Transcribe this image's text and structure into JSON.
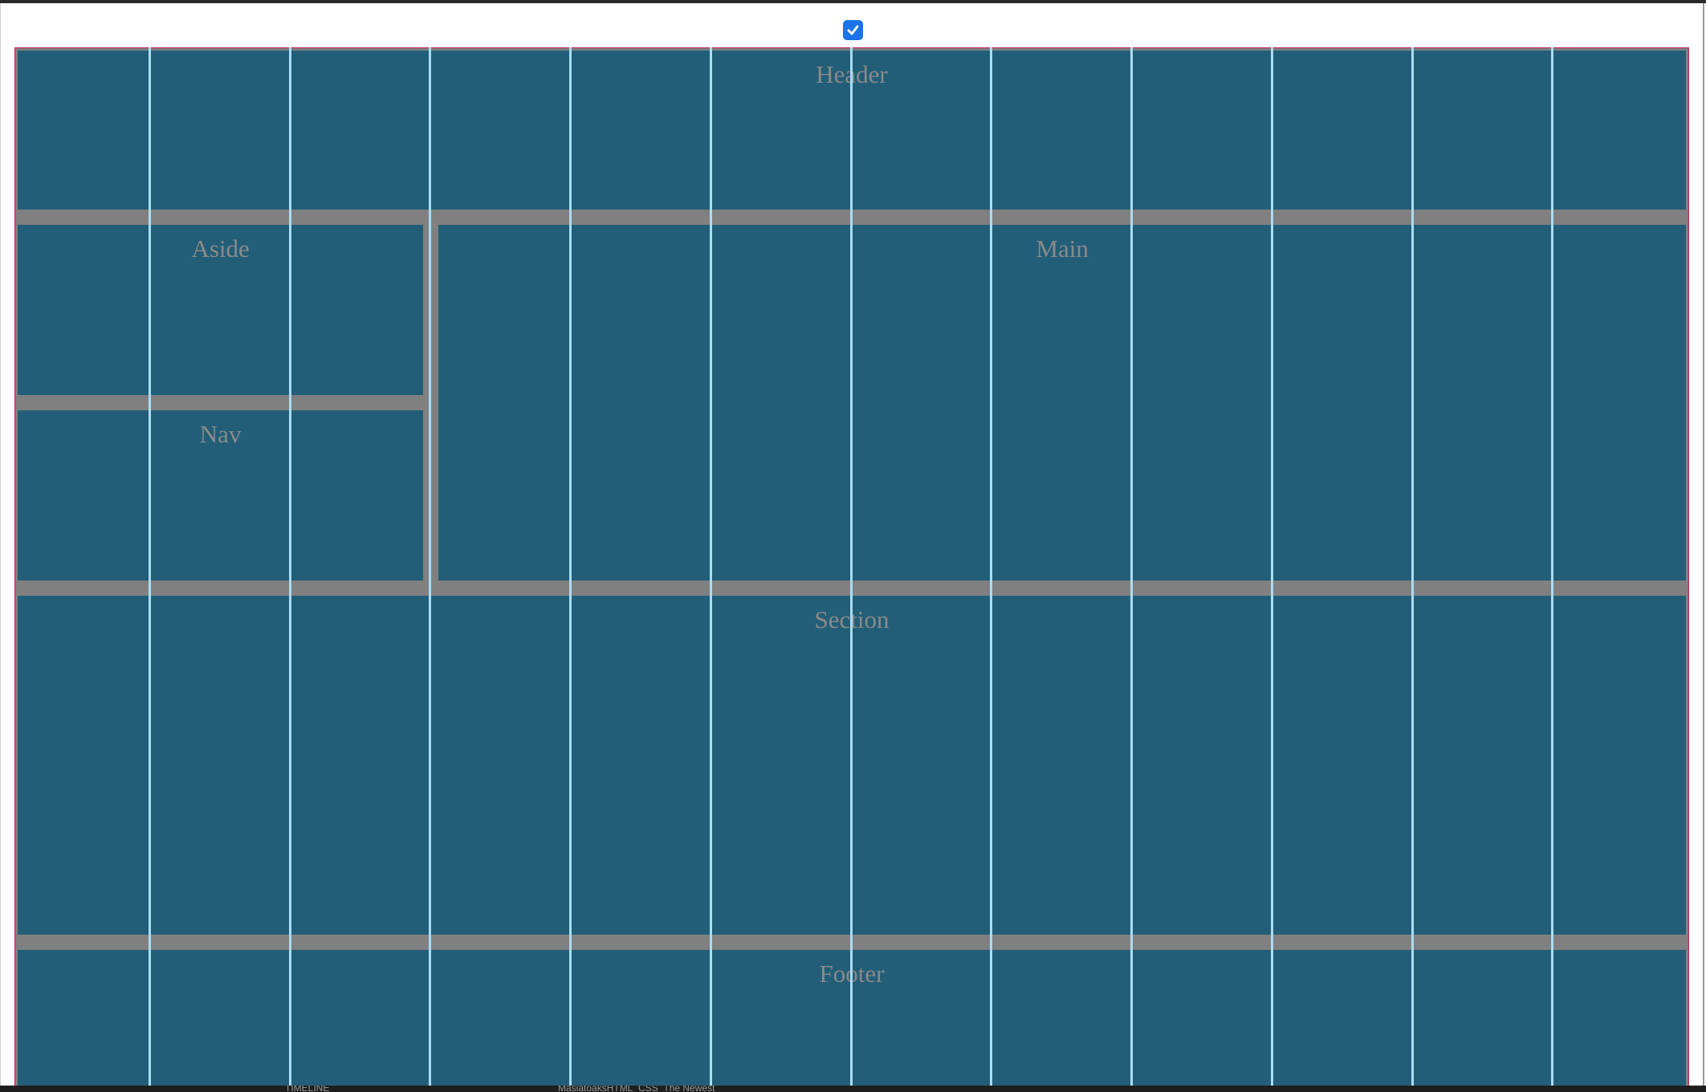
{
  "toggle": {
    "checked": true
  },
  "grid": {
    "columns": 12,
    "areas": {
      "header": "Header",
      "aside": "Aside",
      "nav": "Nav",
      "main": "Main",
      "section": "Section",
      "footer": "Footer"
    }
  },
  "colors": {
    "area_bg": "#235e78",
    "gap": "#808080",
    "column_line": "#a9ddf5",
    "container_border": "#c21e56",
    "checkbox": "#1a73e8"
  },
  "statusbar": {
    "left": "TIMELINE",
    "right": "MasiatoaksHTML_CSS_The Newest"
  }
}
